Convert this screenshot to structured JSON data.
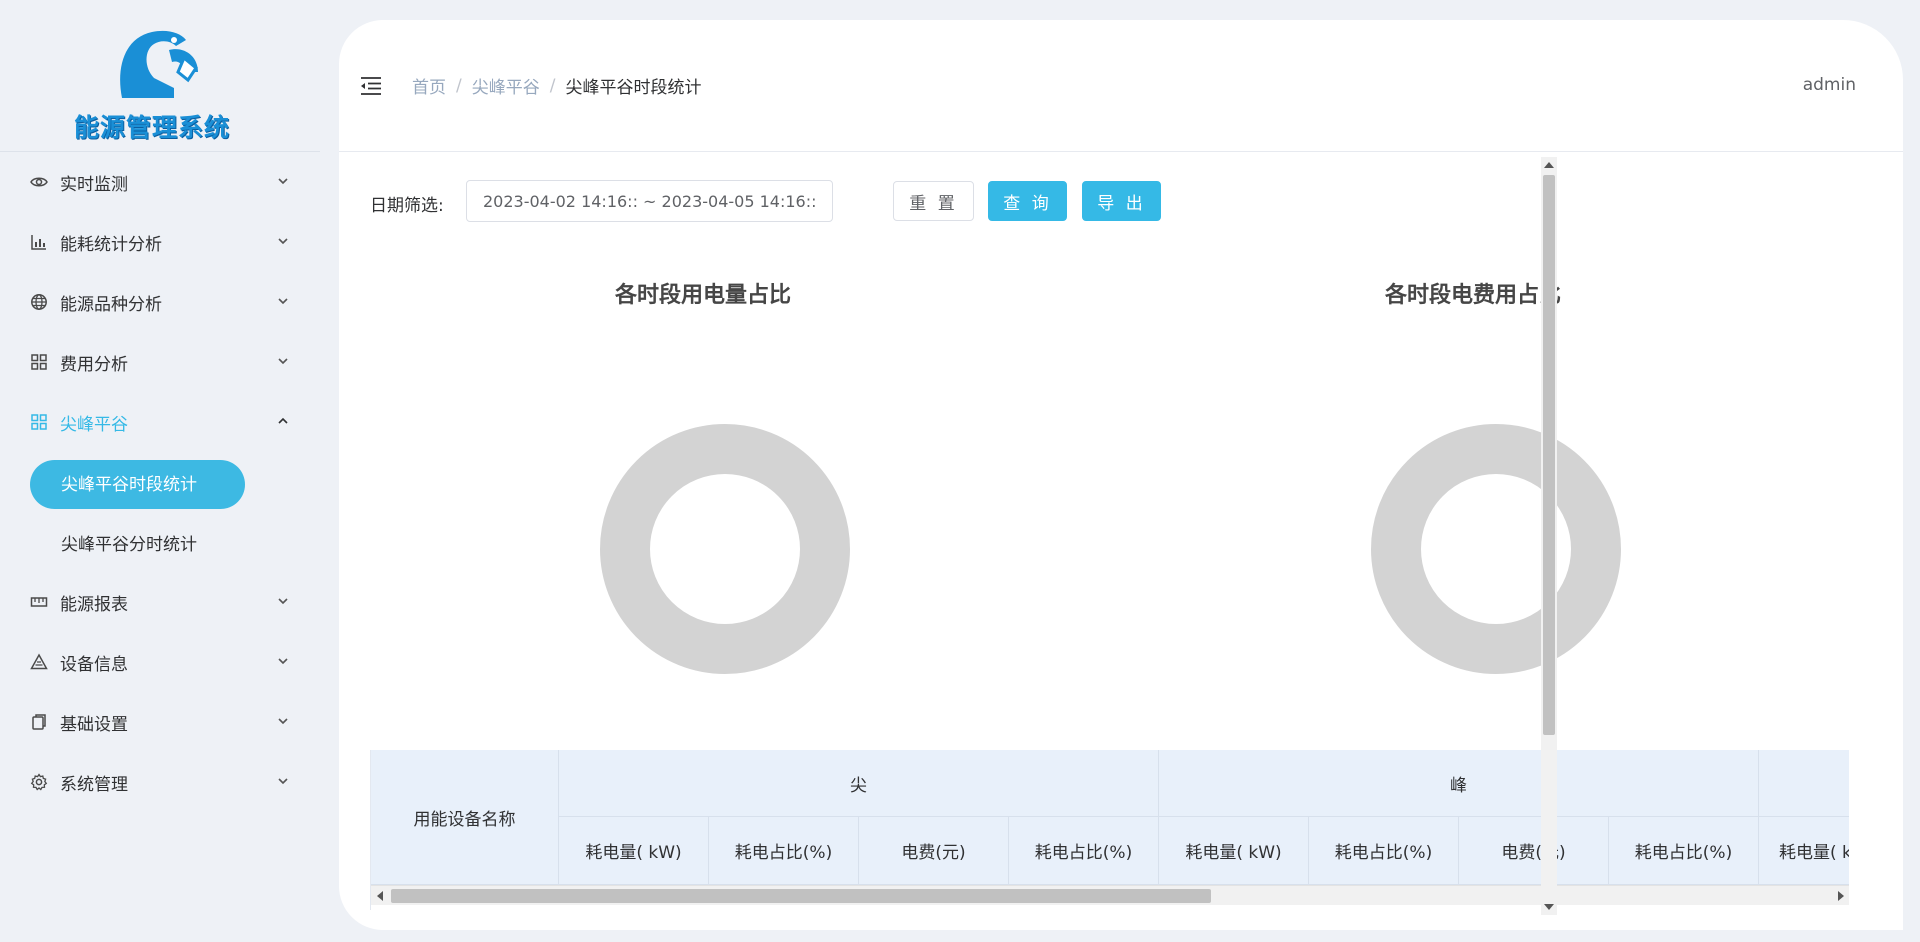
{
  "app": {
    "logo_text": "能源管理系统"
  },
  "sidebar": {
    "items": [
      {
        "label": "实时监测",
        "icon": "eye-icon",
        "open": false
      },
      {
        "label": "能耗统计分析",
        "icon": "bar-chart-icon",
        "open": false
      },
      {
        "label": "能源品种分析",
        "icon": "globe-icon",
        "open": false
      },
      {
        "label": "费用分析",
        "icon": "grid-icon",
        "open": false
      },
      {
        "label": "尖峰平谷",
        "icon": "grid-icon",
        "open": true,
        "children": [
          {
            "label": "尖峰平谷时段统计",
            "active": true
          },
          {
            "label": "尖峰平谷分时统计",
            "active": false
          }
        ]
      },
      {
        "label": "能源报表",
        "icon": "ruler-icon",
        "open": false
      },
      {
        "label": "设备信息",
        "icon": "warning-icon",
        "open": false
      },
      {
        "label": "基础设置",
        "icon": "copy-icon",
        "open": false
      },
      {
        "label": "系统管理",
        "icon": "gear-icon",
        "open": false
      }
    ]
  },
  "header": {
    "breadcrumb": [
      "首页",
      "尖峰平谷",
      "尖峰平谷时段统计"
    ],
    "user": "admin"
  },
  "filter": {
    "label": "日期筛选:",
    "date_range": "2023-04-02 14:16:: ~ 2023-04-05 14:16::",
    "reset_label": "重 置",
    "query_label": "查 询",
    "export_label": "导 出"
  },
  "charts": {
    "left_title": "各时段用电量占比",
    "right_title": "各时段电费用占比",
    "empty_color": "#d3d3d3"
  },
  "chart_data": [
    {
      "type": "pie",
      "title": "各时段用电量占比",
      "values": [],
      "labels": [],
      "style": "donut-empty"
    },
    {
      "type": "pie",
      "title": "各时段电费用占比",
      "values": [],
      "labels": [],
      "style": "donut-empty"
    }
  ],
  "table": {
    "device_header": "用能设备名称",
    "groups": [
      "尖",
      "峰"
    ],
    "sub_headers": [
      "耗电量( kW)",
      "耗电占比(%)",
      "电费(元)",
      "耗电占比(%)",
      "耗电量( kW)",
      "耗电占比(%)",
      "电费(元)",
      "耗电占比(%)",
      "耗电量( k"
    ]
  },
  "colors": {
    "accent": "#35b9e6",
    "header_bg": "#e8f0fa"
  }
}
